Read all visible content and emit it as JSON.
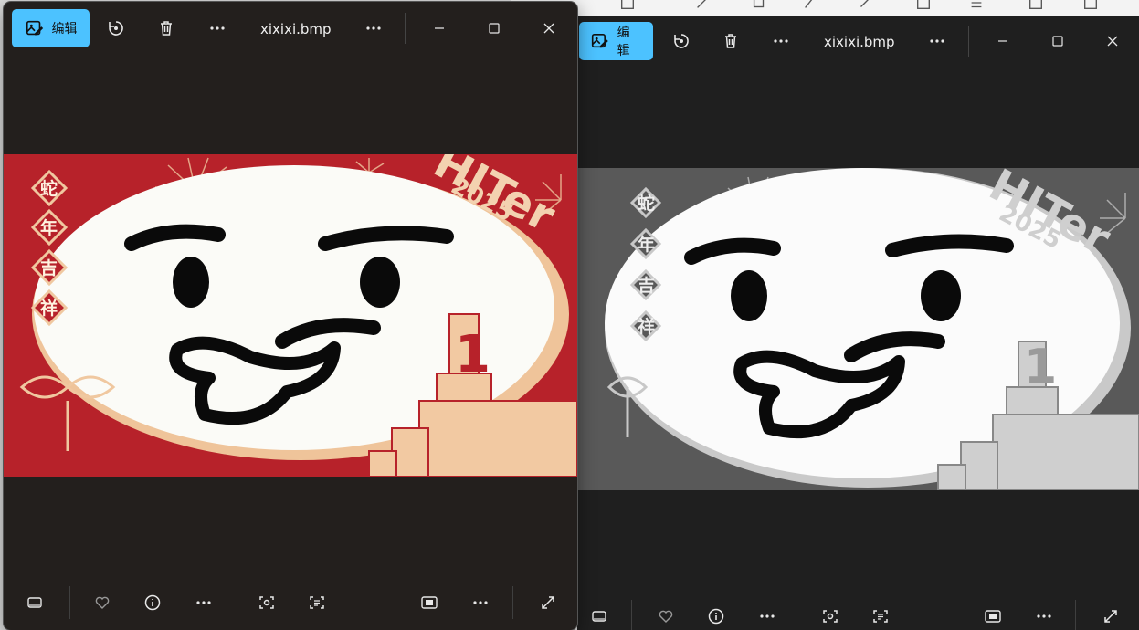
{
  "window_left": {
    "edit_label": "编辑",
    "filename": "xixixi.bmp",
    "image_colors": {
      "background": "#b8232a",
      "face": "#fbfbf7",
      "gold": "#f0c8a0",
      "ink": "#0a0a0a"
    },
    "image_text": {
      "year": "2025",
      "brand": "HITer",
      "chars": [
        "蛇",
        "年",
        "吉",
        "祥"
      ],
      "number": "1"
    }
  },
  "window_right": {
    "edit_label": "编辑",
    "filename": "xixixi.bmp",
    "image_colors": {
      "background": "#5a5a5a",
      "face": "#fbfbfb",
      "gold": "#c8c8c8",
      "ink": "#0a0a0a"
    },
    "image_text": {
      "year": "2025",
      "brand": "HITer",
      "chars": [
        "蛇",
        "年",
        "吉",
        "祥"
      ],
      "number": "1"
    }
  }
}
